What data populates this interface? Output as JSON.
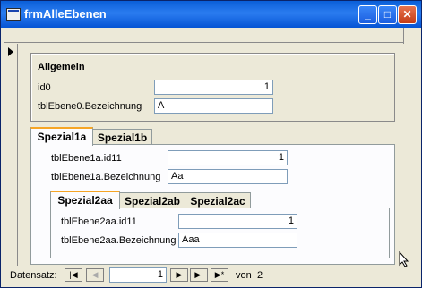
{
  "window": {
    "title": "frmAlleEbenen"
  },
  "section_allgemein": {
    "title": "Allgemein",
    "fields": [
      {
        "label": "id0",
        "value": "1"
      },
      {
        "label": "tblEbene0.Bezeichnung",
        "value": "A"
      }
    ]
  },
  "tabs_level1": {
    "tabs": [
      "Spezial1a",
      "Spezial1b"
    ],
    "active": "Spezial1a",
    "fields": [
      {
        "label": "tblEbene1a.id11",
        "value": "1"
      },
      {
        "label": "tblEbene1a.Bezeichnung",
        "value": "Aa"
      }
    ]
  },
  "tabs_level2": {
    "tabs": [
      "Spezial2aa",
      "Spezial2ab",
      "Spezial2ac"
    ],
    "active": "Spezial2aa",
    "fields": [
      {
        "label": "tblEbene2aa.id11",
        "value": "1"
      },
      {
        "label": "tblEbene2aa.Bezeichnung",
        "value": "Aaa"
      }
    ]
  },
  "navigation": {
    "label": "Datensatz:",
    "current": "1",
    "of_label": "von",
    "total": "2",
    "buttons": {
      "first": "|◀",
      "prev": "◀",
      "next": "▶",
      "last": "▶|",
      "new": "▶*"
    }
  }
}
